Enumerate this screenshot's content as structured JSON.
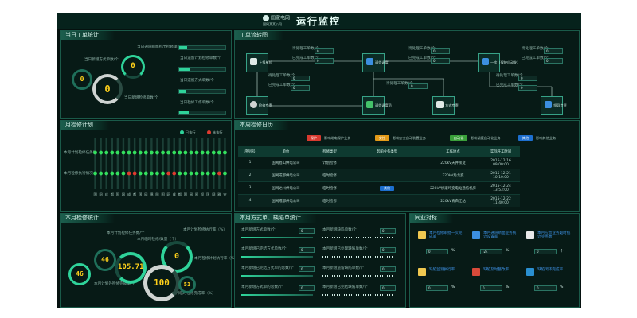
{
  "header": {
    "logo_text": "国家电网",
    "logo_sub": "国网某某公司",
    "title": "运行监控"
  },
  "daily": {
    "title": "当日工单统计",
    "labels": [
      "当日新增方式单数/个",
      "当日通道断面检出检修单数/次",
      "当日新增检修单数/个",
      "当日遗留计划检修单数/个",
      "当日遗留方式单数/个",
      "当日检修工作单数/个"
    ],
    "gauge_values": [
      "0",
      "0",
      "0"
    ],
    "bars": [
      0.18,
      0.22,
      0.15,
      0.2
    ]
  },
  "flow": {
    "title": "工单流转图",
    "nodes": [
      "上报单位",
      "通信调度",
      "一次（保护自动化）",
      "检修专责",
      "通信调度员",
      "方式专责",
      "领导专责"
    ],
    "box_labels": [
      "待处理工单数/个",
      "已完成工单数/个"
    ],
    "box_values": [
      "0",
      "0"
    ],
    "colors": {
      "accent": "#37a287",
      "node_icon_blue": "#3c8fe0",
      "node_icon_green": "#44c26a"
    }
  },
  "monthly_plan": {
    "title": "月检修计划",
    "legend": [
      "已执行",
      "未执行"
    ],
    "row_labels": [
      "本月计划检修任务数",
      "本月检修执行情况"
    ],
    "col_labels": [
      "国",
      "网",
      "成",
      "都",
      "国",
      "网",
      "成",
      "都",
      "国",
      "网",
      "绵",
      "阳",
      "国",
      "网",
      "成",
      "都",
      "国",
      "网",
      "阿",
      "坝",
      "国",
      "网",
      "雅",
      "安"
    ],
    "row1": [
      1,
      1,
      1,
      1,
      1,
      1,
      1,
      1,
      1,
      1,
      1,
      1,
      1,
      1,
      1,
      1,
      1,
      1,
      1,
      1,
      1,
      1,
      1,
      1
    ],
    "row2": [
      1,
      1,
      1,
      1,
      1,
      1,
      0,
      0,
      1,
      1,
      1,
      1,
      1,
      0,
      0,
      1,
      1,
      1,
      1,
      1,
      1,
      1,
      0,
      1
    ]
  },
  "weekly": {
    "title": "本周检修日历",
    "legend": [
      {
        "chip": "保护",
        "text": "影响继电保护业务",
        "color": "#d83a2f"
      },
      {
        "chip": "安控",
        "text": "影响安全自动装置业务",
        "color": "#e39a18"
      },
      {
        "chip": "自动化",
        "text": "影响调度自动化业务",
        "color": "#3aa03a"
      },
      {
        "chip": "其他",
        "text": "影响其他业务",
        "color": "#1d6fcf"
      }
    ],
    "columns": [
      "序列号",
      "单位",
      "检修类型",
      "影响业务类型",
      "工作地点",
      "实际开工时间"
    ],
    "rows": [
      [
        "1",
        "国网眉山供电公司",
        "计划检修",
        "",
        "220kV天井坝变",
        "2015-12-16 09:00:00"
      ],
      [
        "2",
        "国网成都供电公司",
        "临时检修",
        "",
        "220kV角龙变",
        "2015-12-21 10:10:00"
      ],
      [
        "3",
        "国网达州供电公司",
        "临时检修",
        "其他",
        "220kV桃家坪变电站通信机房",
        "2015-12-24 13:53:00"
      ],
      [
        "4",
        "国网成都供电公司",
        "临时检修",
        "",
        "220kV青白江站",
        "2015-12-22 11:40:00"
      ]
    ]
  },
  "monthly_stats": {
    "title": "本月检修统计",
    "labels": [
      "本月计划检修任务数/个",
      "本月临时检修/数量（个）",
      "本月计划检修执行率（%）",
      "本月检修计划执行率（%）",
      "本月计划外检修完成率/个",
      "本月临时检修完成率（%）"
    ],
    "values": [
      "46",
      "105.71",
      "0",
      "100",
      "51",
      "0"
    ]
  },
  "method": {
    "title": "本月方式单、缺陷单统计",
    "labels": [
      "本月新增方式单数/个",
      "本月新增缺陷单数/个",
      "本月新增已完结方式单数/个",
      "本月新增已处理缺陷单数/个",
      "本月新增已完结方式单的总数/个",
      "本月新增遗留缺陷单数/个",
      "本月新增方式单的总数/个",
      "本月新增已完结缺陷单数/个"
    ],
    "values": [
      "0",
      "0",
      "0",
      "0",
      "0",
      "0",
      "0",
      "0"
    ]
  },
  "indicators": {
    "title": "同业对标",
    "items": [
      {
        "label": "本月检修审批一次完成率",
        "value": "0",
        "unit": "%"
      },
      {
        "label": "本月通道断面业务统计设置率",
        "value": "-24",
        "unit": "%"
      },
      {
        "label": "本月应急业务超时统计业务数",
        "value": "0",
        "unit": "个"
      },
      {
        "label": "缺陷监测执行率",
        "value": "0",
        "unit": "%"
      },
      {
        "label": "缺陷及时整改率",
        "value": "0",
        "unit": "%"
      },
      {
        "label": "缺陷闭环完成率",
        "value": "0",
        "unit": "%"
      }
    ]
  }
}
